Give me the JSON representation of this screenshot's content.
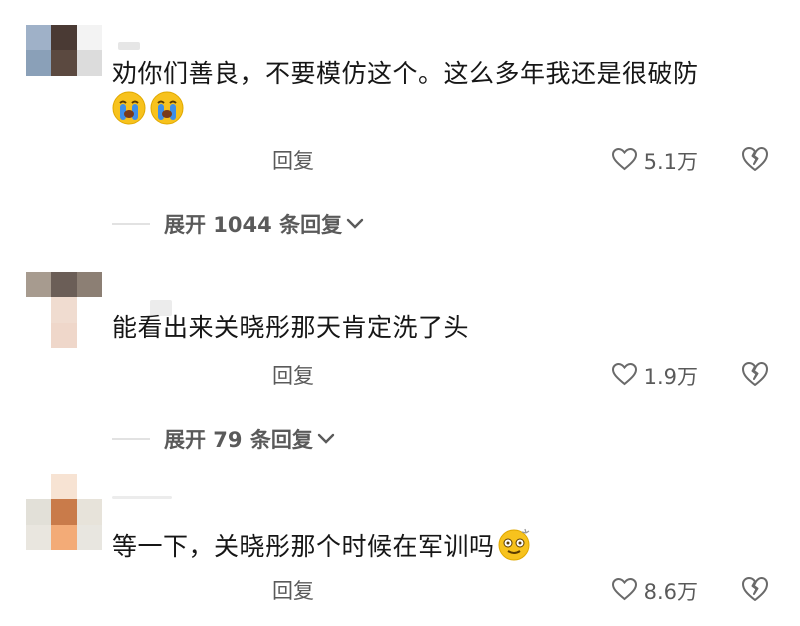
{
  "comments": [
    {
      "text": "劝你们善良，不要模仿这个。这么多年我还是很破防",
      "emojis": [
        "crying-face-icon",
        "crying-face-icon"
      ],
      "reply_label": "回复",
      "likes": "5.1万",
      "expand_label": "展开 1044 条回复"
    },
    {
      "text": "能看出来关晓彤那天肯定洗了头",
      "reply_label": "回复",
      "likes": "1.9万",
      "expand_label": "展开 79 条回复"
    },
    {
      "text": "等一下，关晓彤那个时候在军训吗",
      "emojis": [
        "dizzy-face-icon"
      ],
      "reply_label": "回复",
      "likes": "8.6万"
    }
  ],
  "colors": {
    "secondary_text": "#5a5a5a",
    "primary_text": "#161616",
    "emoji_yellow": "#f7c21d",
    "tear_blue": "#3e8ee8"
  }
}
